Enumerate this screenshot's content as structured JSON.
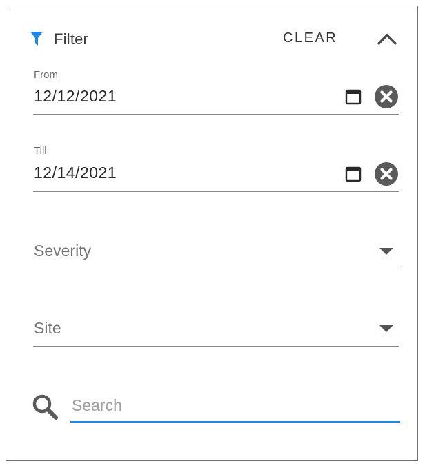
{
  "header": {
    "title": "Filter",
    "clear_label": "CLEAR",
    "filter_icon_color": "#1e88e5"
  },
  "from": {
    "caption": "From",
    "value": "12/12/2021"
  },
  "till": {
    "caption": "Till",
    "value": "12/14/2021"
  },
  "severity": {
    "placeholder": "Severity"
  },
  "site": {
    "placeholder": "Site"
  },
  "search": {
    "placeholder": "Search",
    "accent_color": "#1e88e5"
  },
  "icons": {
    "filter": "filter-icon",
    "collapse": "chevron-up-icon",
    "calendar": "calendar-icon",
    "clear": "close-circle-icon",
    "dropdown": "caret-down-icon",
    "search": "search-icon"
  }
}
